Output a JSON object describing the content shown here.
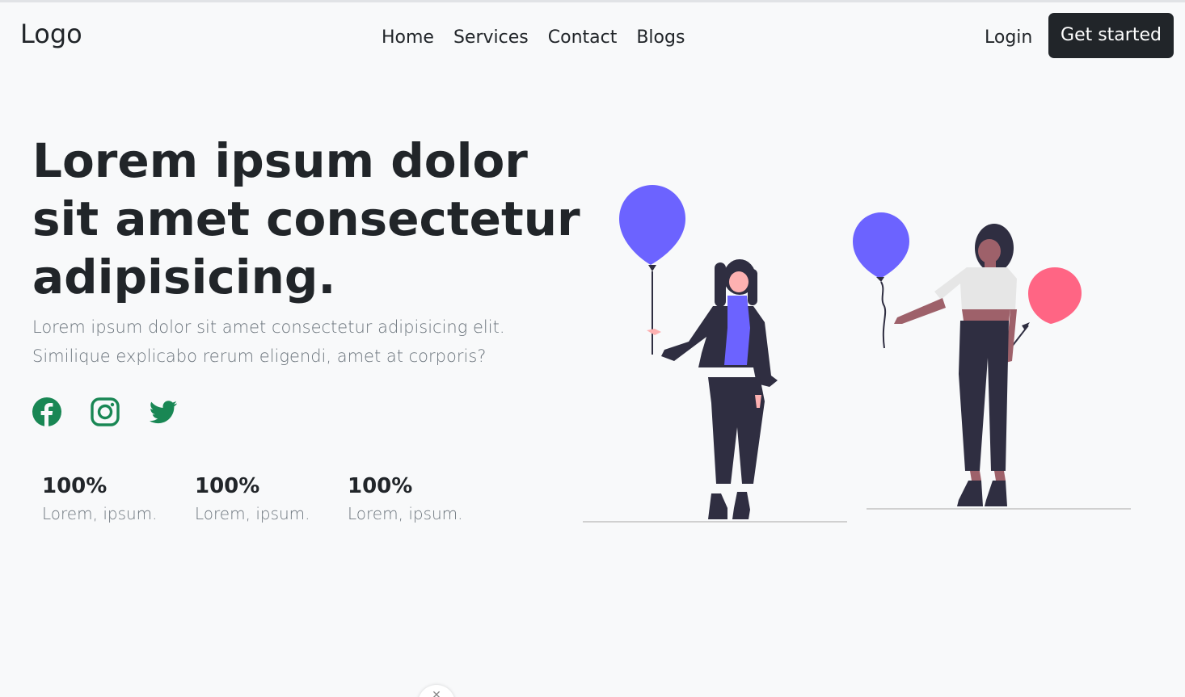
{
  "header": {
    "logo": "Logo",
    "nav": [
      "Home",
      "Services",
      "Contact",
      "Blogs"
    ],
    "login": "Login",
    "cta": "Get started"
  },
  "hero": {
    "title": "Lorem ipsum dolor sit amet consectetur adipisicing.",
    "subtitle": "Lorem ipsum dolor sit amet consectetur adipisicing elit. Similique explicabo rerum eligendi, amet at corporis?"
  },
  "socials": [
    {
      "icon": "facebook-icon"
    },
    {
      "icon": "instagram-icon"
    },
    {
      "icon": "twitter-icon"
    }
  ],
  "stats": [
    {
      "value": "100%",
      "label": "Lorem, ipsum."
    },
    {
      "value": "100%",
      "label": "Lorem, ipsum."
    },
    {
      "value": "100%",
      "label": "Lorem, ipsum."
    }
  ],
  "colors": {
    "accent_green": "#198754",
    "dark": "#212529",
    "balloon_purple": "#6c63ff",
    "balloon_pink": "#ff6584"
  }
}
